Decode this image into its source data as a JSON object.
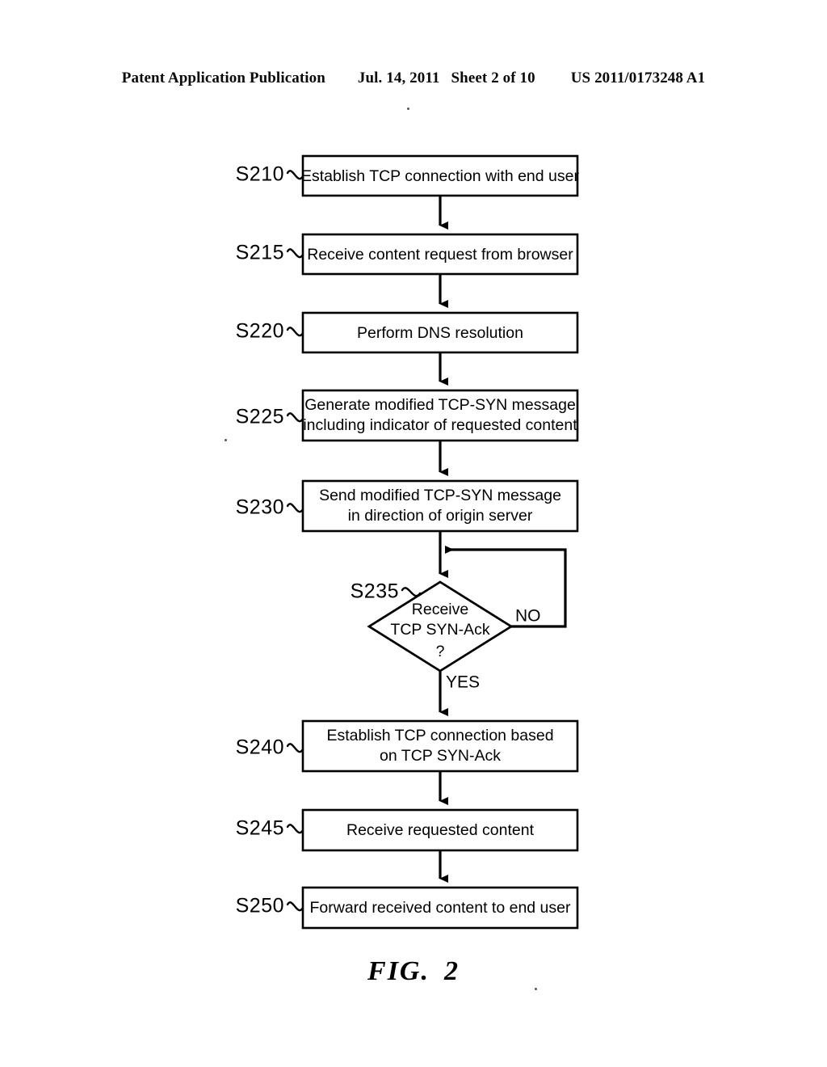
{
  "header": {
    "publication": "Patent Application Publication",
    "date": "Jul. 14, 2011",
    "sheet": "Sheet 2 of 10",
    "patent_number": "US 2011/0173248 A1"
  },
  "figure": {
    "label": "FIG.",
    "number": "2"
  },
  "flowchart": {
    "steps": [
      {
        "id": "S210",
        "lines": [
          "Establish TCP connection with end user"
        ]
      },
      {
        "id": "S215",
        "lines": [
          "Receive content request from browser"
        ]
      },
      {
        "id": "S220",
        "lines": [
          "Perform DNS resolution"
        ]
      },
      {
        "id": "S225",
        "lines": [
          "Generate modified TCP-SYN message",
          "including indicator of requested content"
        ]
      },
      {
        "id": "S230",
        "lines": [
          "Send modified TCP-SYN message",
          "in direction of origin server"
        ]
      },
      {
        "id": "S240",
        "lines": [
          "Establish TCP connection based",
          "on TCP SYN-Ack"
        ]
      },
      {
        "id": "S245",
        "lines": [
          "Receive requested content"
        ]
      },
      {
        "id": "S250",
        "lines": [
          "Forward received content to end user"
        ]
      }
    ],
    "decision": {
      "id": "S235",
      "lines": [
        "Receive",
        "TCP SYN-Ack",
        "?"
      ],
      "yes_label": "YES",
      "no_label": "NO"
    }
  },
  "colors": {
    "ink": "#000000",
    "paper": "#ffffff"
  }
}
